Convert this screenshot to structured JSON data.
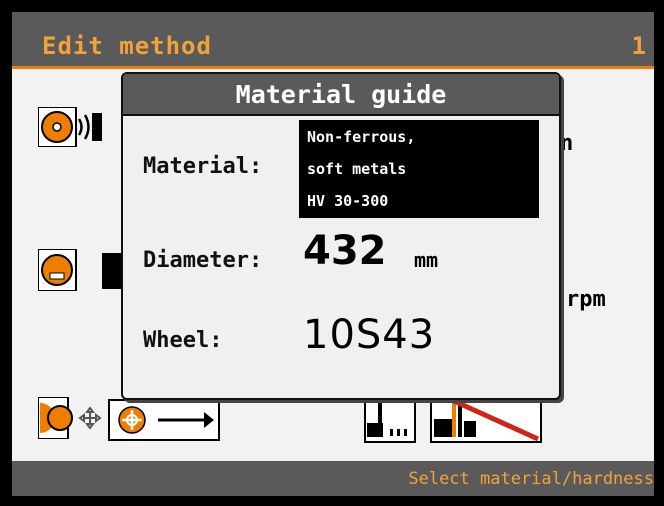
{
  "header": {
    "title": "Edit method",
    "page": "1"
  },
  "dialog": {
    "title": "Material guide",
    "material_label": "Material:",
    "material_lines": [
      "Non-ferrous,",
      "soft metals",
      "HV 30-300"
    ],
    "diameter_label": "Diameter:",
    "diameter_value": "432",
    "diameter_unit": "mm",
    "wheel_label": "Wheel:",
    "wheel_value": "10S43"
  },
  "background_fields": {
    "right_text_1": "n",
    "right_text_2": "rpm"
  },
  "status": {
    "text": "Select material/hardness"
  },
  "colors": {
    "accent": "#ef7d00",
    "title_text": "#f2a23a",
    "bar": "#5a5a5a",
    "content_bg": "#f2f2f2"
  },
  "icons": [
    "grinding-wheel-icon",
    "wheel-speed-icon",
    "wheel-position-icon",
    "target-arrow-icon",
    "dressing-step-icon",
    "dressing-cancel-icon"
  ]
}
